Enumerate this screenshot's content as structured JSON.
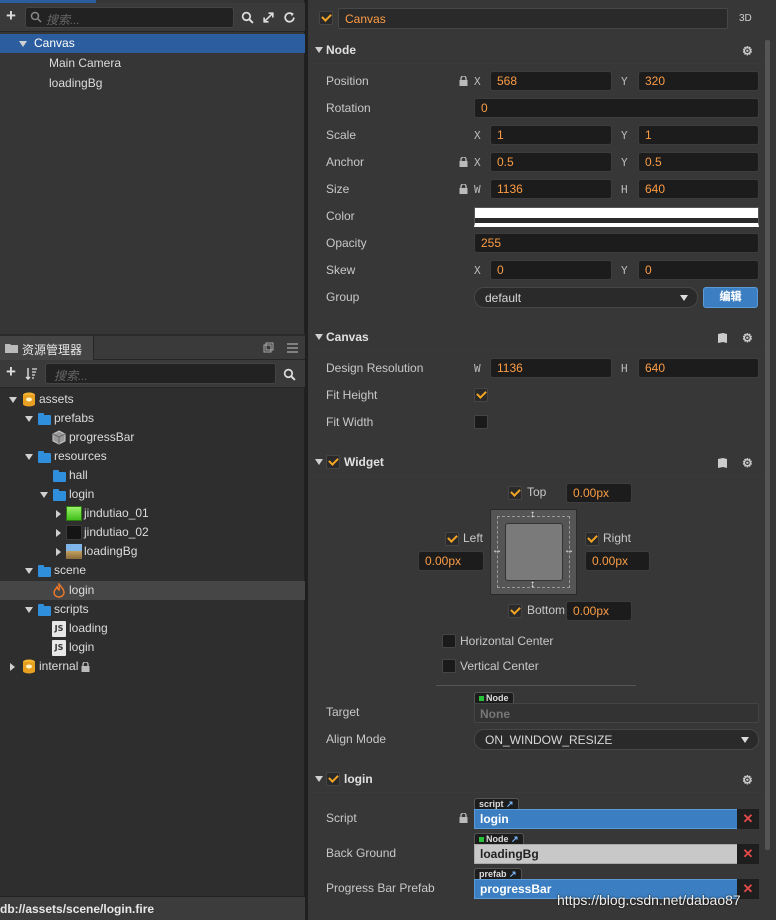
{
  "hierarchy": {
    "search_placeholder": "搜索...",
    "items": [
      {
        "label": "Canvas"
      },
      {
        "label": "Main Camera"
      },
      {
        "label": "loadingBg"
      }
    ]
  },
  "assets": {
    "title": "资源管理器",
    "search_placeholder": "搜索...",
    "tree": {
      "assets": "assets",
      "prefabs": "prefabs",
      "progressBar": "progressBar",
      "resources": "resources",
      "hall": "hall",
      "login_folder": "login",
      "jindutiao_01": "jindutiao_01",
      "jindutiao_02": "jindutiao_02",
      "loadingBg": "loadingBg",
      "scene": "scene",
      "login_scene": "login",
      "scripts": "scripts",
      "loading": "loading",
      "login_script": "login",
      "internal": "internal"
    },
    "status_path": "db://assets/scene/login.fire"
  },
  "inspector": {
    "node_name": "Canvas",
    "mode_label": "3D",
    "node": {
      "title": "Node",
      "position": {
        "label": "Position",
        "x": "568",
        "y": "320"
      },
      "rotation": {
        "label": "Rotation",
        "value": "0"
      },
      "scale": {
        "label": "Scale",
        "x": "1",
        "y": "1"
      },
      "anchor": {
        "label": "Anchor",
        "x": "0.5",
        "y": "0.5"
      },
      "size": {
        "label": "Size",
        "w": "1136",
        "h": "640"
      },
      "color": {
        "label": "Color",
        "value": "#ffffff"
      },
      "opacity": {
        "label": "Opacity",
        "value": "255"
      },
      "skew": {
        "label": "Skew",
        "x": "0",
        "y": "0"
      },
      "group": {
        "label": "Group",
        "value": "default",
        "edit_label": "编辑"
      }
    },
    "axis": {
      "x": "X",
      "y": "Y",
      "w": "W",
      "h": "H"
    },
    "canvas": {
      "title": "Canvas",
      "design_resolution": {
        "label": "Design Resolution",
        "w": "1136",
        "h": "640"
      },
      "fit_height": {
        "label": "Fit Height",
        "checked": true
      },
      "fit_width": {
        "label": "Fit Width",
        "checked": false
      }
    },
    "widget": {
      "title": "Widget",
      "top": {
        "label": "Top",
        "value": "0.00px",
        "checked": true
      },
      "left": {
        "label": "Left",
        "value": "0.00px",
        "checked": true
      },
      "right": {
        "label": "Right",
        "value": "0.00px",
        "checked": true
      },
      "bottom": {
        "label": "Bottom",
        "value": "0.00px",
        "checked": true
      },
      "horizontal_center": "Horizontal Center",
      "vertical_center": "Vertical Center",
      "target": {
        "label": "Target",
        "tag": "Node",
        "value": "None"
      },
      "align_mode": {
        "label": "Align Mode",
        "value": "ON_WINDOW_RESIZE"
      }
    },
    "login": {
      "title": "login",
      "script": {
        "label": "Script",
        "tag": "script",
        "value": "login"
      },
      "back_ground": {
        "label": "Back Ground",
        "tag": "Node",
        "value": "loadingBg"
      },
      "progress_bar_prefab": {
        "label": "Progress Bar Prefab",
        "tag": "prefab",
        "value": "progressBar"
      }
    }
  },
  "watermark": "https://blog.csdn.net/dabao87",
  "colors": {
    "accent": "#fb9c45",
    "selection": "#2c5d9f",
    "blue_field": "#3b7fc2",
    "checkbox": "#f5a623"
  }
}
